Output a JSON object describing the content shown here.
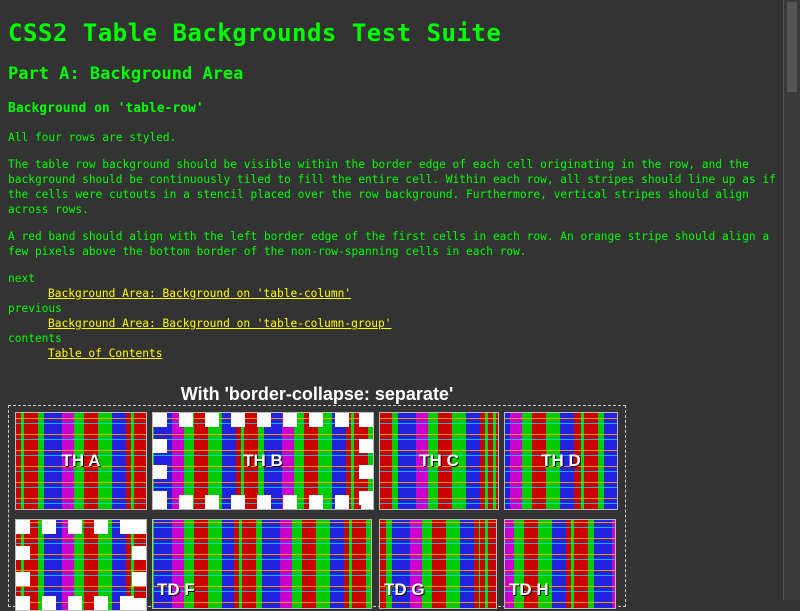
{
  "page": {
    "title": "CSS2 Table Backgrounds Test Suite",
    "part": "Part A: Background Area",
    "section": "Background on 'table-row'",
    "para1": "All four rows are styled.",
    "para2": "The table row background should be visible within the border edge of each cell originating in the row, and the background should be continuously tiled to fill the entire cell. Within each row, all stripes should line up as if the cells were cutouts in a stencil placed over the row background. Furthermore, vertical stripes should align across rows.",
    "para3": "A red band should align with the left border edge of the first cells in each row. An orange stripe should align a few pixels above the bottom border of the non-row-spanning cells in each row."
  },
  "nav": {
    "next_label": "next",
    "next_link": "Background Area: Background on 'table-column'",
    "prev_label": "previous",
    "prev_link": "Background Area: Background on 'table-column-group'",
    "contents_label": "contents",
    "contents_link": "Table of Contents"
  },
  "table": {
    "caption": "With 'border-collapse: separate'",
    "cells": {
      "th_a": "TH A",
      "th_b": "TH B",
      "th_c": "TH C",
      "th_d": "TH D",
      "td_f": "TD F",
      "td_g": "TD G",
      "td_h": "TD H"
    }
  },
  "colors": {
    "background": "#333333",
    "text": "#00ff00",
    "link": "#ffff00",
    "caption": "#ffffff"
  }
}
